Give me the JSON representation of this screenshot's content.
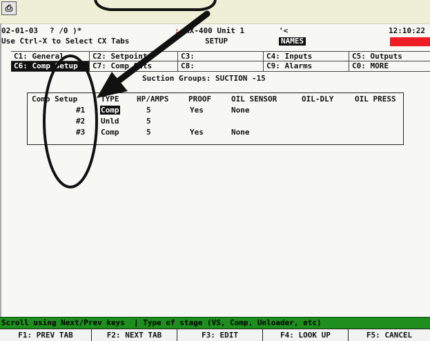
{
  "toolbar": {
    "icon": "printer-icon"
  },
  "status_line": {
    "date": "02-01-03",
    "flags": "? /0 )*",
    "unit": "RX-400 Unit 1",
    "unit_prefix": ":",
    "mark": "'<",
    "time": "12:10:22"
  },
  "hint_line": {
    "text": "Use Ctrl-X to Select CX Tabs",
    "mode": "SETUP",
    "names_badge": "NAMES"
  },
  "tabs_row1": [
    {
      "label": "C1: General"
    },
    {
      "label": "C2: Setpoints"
    },
    {
      "label": "C3:"
    },
    {
      "label": "C4: Inputs"
    },
    {
      "label": "C5: Outputs"
    }
  ],
  "tabs_row2": [
    {
      "label": "C6: Comp Setup"
    },
    {
      "label": "C7: Comp Outs"
    },
    {
      "label": "C8:"
    },
    {
      "label": "C9: Alarms"
    },
    {
      "label": "C0: MORE"
    }
  ],
  "suction_groups": "Suction Groups: SUCTION -15",
  "table": {
    "headers": [
      "Comp Setup",
      "TYPE",
      "HP/AMPS",
      "PROOF",
      "OIL SENSOR",
      "OIL-DLY",
      "OIL PRESS"
    ],
    "rows": [
      {
        "num": "#1",
        "sep": ":",
        "type": "Comp",
        "hp": "5",
        "proof": "Yes",
        "oil_sensor": "None"
      },
      {
        "num": "#2",
        "sep": ":",
        "type": "Unld",
        "hp": "5",
        "proof": "",
        "oil_sensor": ""
      },
      {
        "num": "#3",
        "sep": ":",
        "type": "Comp",
        "hp": "5",
        "proof": "Yes",
        "oil_sensor": "None"
      }
    ]
  },
  "status_bar": "Scroll using Next/Prev keys  | Type of stage (VS, Comp, Unloader, etc)",
  "function_keys": [
    {
      "label": "F1: PREV TAB"
    },
    {
      "label": "F2: NEXT TAB"
    },
    {
      "label": "F3: EDIT"
    },
    {
      "label": "F4: LOOK UP"
    },
    {
      "label": "F5: CANCEL"
    }
  ],
  "colors": {
    "status_bar": "#1e8e1e",
    "alarm_block": "#ee1c25",
    "annotation": "#111111"
  }
}
